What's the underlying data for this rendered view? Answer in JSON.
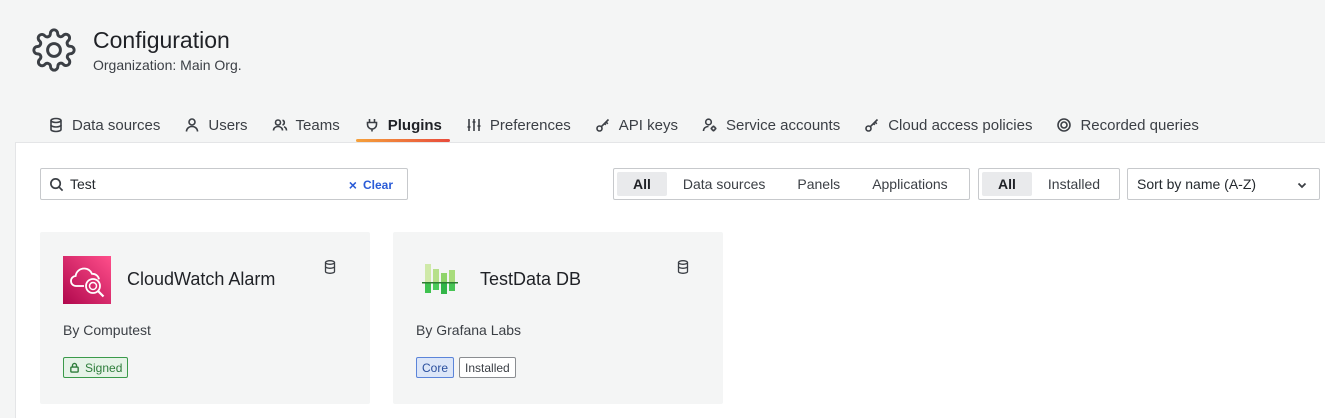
{
  "header": {
    "title": "Configuration",
    "subtitle": "Organization: Main Org."
  },
  "tabs": [
    {
      "label": "Data sources",
      "icon": "database-icon",
      "active": false
    },
    {
      "label": "Users",
      "icon": "user-icon",
      "active": false
    },
    {
      "label": "Teams",
      "icon": "users-icon",
      "active": false
    },
    {
      "label": "Plugins",
      "icon": "plug-icon",
      "active": true
    },
    {
      "label": "Preferences",
      "icon": "sliders-icon",
      "active": false
    },
    {
      "label": "API keys",
      "icon": "key-icon",
      "active": false
    },
    {
      "label": "Service accounts",
      "icon": "user-cog-icon",
      "active": false
    },
    {
      "label": "Cloud access policies",
      "icon": "key-icon",
      "active": false
    },
    {
      "label": "Recorded queries",
      "icon": "record-icon",
      "active": false
    }
  ],
  "search": {
    "value": "Test",
    "clear_label": "Clear"
  },
  "type_filter": {
    "options": [
      "All",
      "Data sources",
      "Panels",
      "Applications"
    ],
    "selected": "All"
  },
  "install_filter": {
    "options": [
      "All",
      "Installed"
    ],
    "selected": "All"
  },
  "sort": {
    "selected": "Sort by name (A-Z)"
  },
  "cards": [
    {
      "name": "CloudWatch Alarm",
      "author": "By Computest",
      "badges": [
        {
          "label": "Signed",
          "kind": "signed"
        }
      ],
      "type_icon": "database-icon"
    },
    {
      "name": "TestData DB",
      "author": "By Grafana Labs",
      "badges": [
        {
          "label": "Core",
          "kind": "core"
        },
        {
          "label": "Installed",
          "kind": "installed"
        }
      ],
      "type_icon": "database-icon"
    }
  ],
  "colors": {
    "accent_gradient_start": "#f5a13b",
    "accent_gradient_end": "#e84b3c",
    "link": "#2a5bd7",
    "signed_green": "#2d7d3a",
    "cloudwatch_pink": "#e7157b"
  }
}
